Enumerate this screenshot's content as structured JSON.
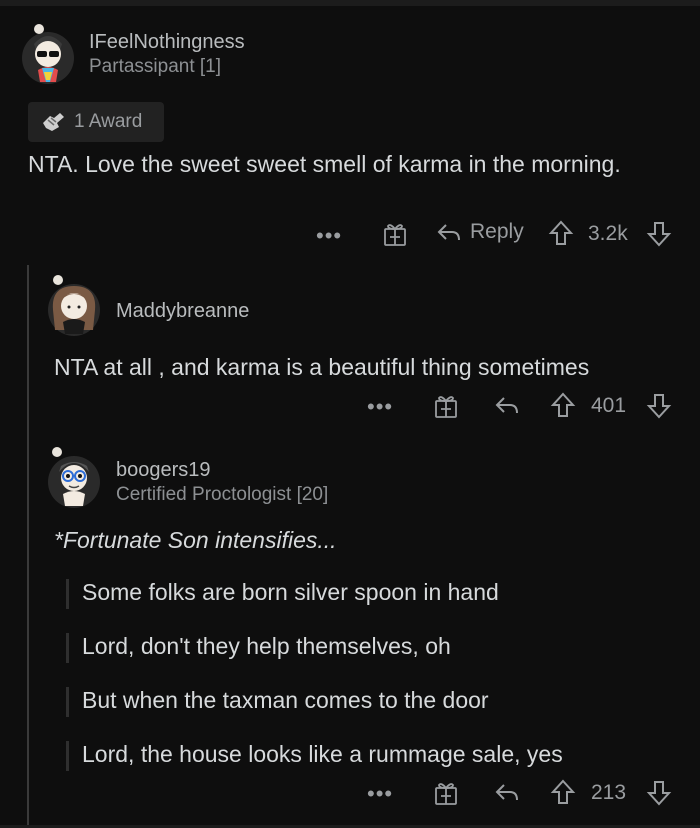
{
  "comment1": {
    "username": "IFeelNothingness",
    "flair": "Partassipant [1]",
    "award_text": "1 Award",
    "body": "NTA. Love the sweet sweet smell of karma in the morning.",
    "actions": {
      "more": "•••",
      "reply_label": "Reply",
      "score": "3.2k"
    }
  },
  "comment2": {
    "username": "Maddybreanne",
    "body": "NTA at all , and karma is a beautiful thing sometimes",
    "actions": {
      "more": "•••",
      "score": "401"
    }
  },
  "comment3": {
    "username": "boogers19",
    "flair": "Certified Proctologist [20]",
    "intro": "*Fortunate Son intensifies...",
    "quotes": [
      "Some folks are born silver spoon in hand",
      "Lord, don't they help themselves, oh",
      "But when the taxman comes to the door",
      "Lord, the house looks like a rummage sale, yes"
    ],
    "actions": {
      "more": "•••",
      "score": "213"
    }
  },
  "icons": [
    "user-avatar-icon",
    "award-icon",
    "gift-icon",
    "reply-icon",
    "upvote-icon",
    "downvote-icon"
  ],
  "colors": {
    "background": "#0e0e0e",
    "text": "#d7dadc",
    "muted": "#9a9da0",
    "thread": "#3a3a3a"
  }
}
